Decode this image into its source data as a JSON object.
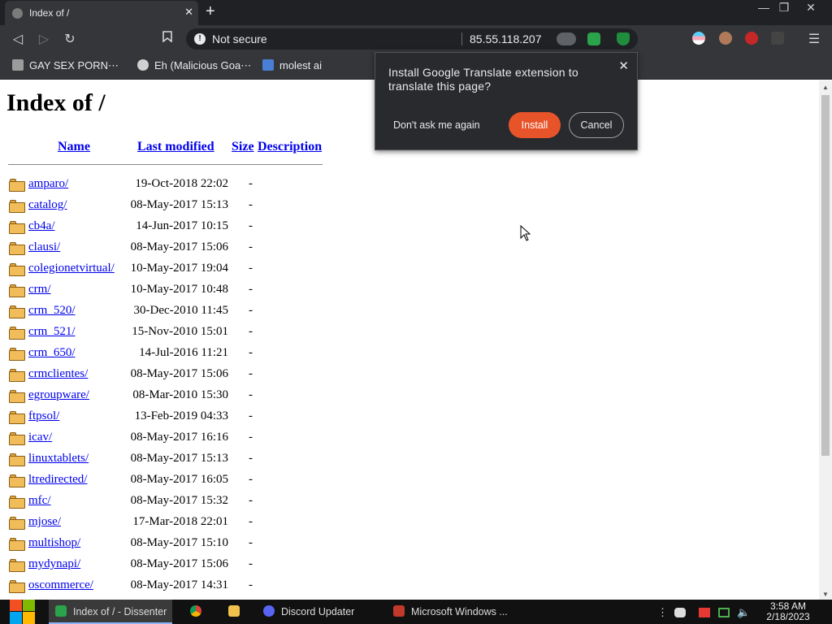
{
  "browser": {
    "tab_title": "Index of /",
    "tab_close": "✕",
    "new_tab": "+",
    "window_minimize": "—",
    "window_restore": "❐",
    "window_close": "✕",
    "security_label": "Not secure",
    "url": "85.55.118.207"
  },
  "bookmarks": [
    {
      "label": "GAY SEX PORN⋯",
      "icon_color": "#9c9c9c"
    },
    {
      "label": "Eh (Malicious Goa⋯",
      "icon_color": "#d0d0d0"
    },
    {
      "label": "molest ai",
      "icon_color": "#4a7fd6"
    }
  ],
  "page": {
    "heading": "Index of /",
    "columns": {
      "name": "Name",
      "modified": "Last modified",
      "size": "Size",
      "description": "Description"
    },
    "rows": [
      {
        "name": "amparo/",
        "modified": "19-Oct-2018 22:02",
        "size": "-"
      },
      {
        "name": "catalog/",
        "modified": "08-May-2017 15:13",
        "size": "-"
      },
      {
        "name": "cb4a/",
        "modified": "14-Jun-2017 10:15",
        "size": "-"
      },
      {
        "name": "clausi/",
        "modified": "08-May-2017 15:06",
        "size": "-"
      },
      {
        "name": "colegionetvirtual/",
        "modified": "10-May-2017 19:04",
        "size": "-"
      },
      {
        "name": "crm/",
        "modified": "10-May-2017 10:48",
        "size": "-"
      },
      {
        "name": "crm_520/",
        "modified": "30-Dec-2010 11:45",
        "size": "-"
      },
      {
        "name": "crm_521/",
        "modified": "15-Nov-2010 15:01",
        "size": "-"
      },
      {
        "name": "crm_650/",
        "modified": "14-Jul-2016 11:21",
        "size": "-"
      },
      {
        "name": "crmclientes/",
        "modified": "08-May-2017 15:06",
        "size": "-"
      },
      {
        "name": "egroupware/",
        "modified": "08-Mar-2010 15:30",
        "size": "-"
      },
      {
        "name": "ftpsol/",
        "modified": "13-Feb-2019 04:33",
        "size": "-"
      },
      {
        "name": "icav/",
        "modified": "08-May-2017 16:16",
        "size": "-"
      },
      {
        "name": "linuxtablets/",
        "modified": "08-May-2017 15:13",
        "size": "-"
      },
      {
        "name": "ltredirected/",
        "modified": "08-May-2017 16:05",
        "size": "-"
      },
      {
        "name": "mfc/",
        "modified": "08-May-2017 15:32",
        "size": "-"
      },
      {
        "name": "mjose/",
        "modified": "17-Mar-2018 22:01",
        "size": "-"
      },
      {
        "name": "multishop/",
        "modified": "08-May-2017 15:10",
        "size": "-"
      },
      {
        "name": "mydynapi/",
        "modified": "08-May-2017 15:06",
        "size": "-"
      },
      {
        "name": "oscommerce/",
        "modified": "08-May-2017 14:31",
        "size": "-"
      }
    ]
  },
  "translate_popup": {
    "message": "Install Google Translate extension to translate this page?",
    "dont_ask": "Don't ask me again",
    "install": "Install",
    "cancel": "Cancel",
    "close": "✕"
  },
  "taskbar": {
    "items": [
      {
        "label": "Index of / - Dissenter",
        "icon_color": "#2aa34a",
        "active": true
      },
      {
        "label": "Discord Updater",
        "icon_color": "#5865f2",
        "active": false
      },
      {
        "label": "Microsoft Windows ...",
        "icon_color": "#c0392b",
        "active": false
      }
    ],
    "time": "3:58 AM",
    "date": "2/18/2023"
  },
  "colors": {
    "link": "#0000ee",
    "install_button": "#e8542a",
    "chrome_dark": "#35363a"
  }
}
